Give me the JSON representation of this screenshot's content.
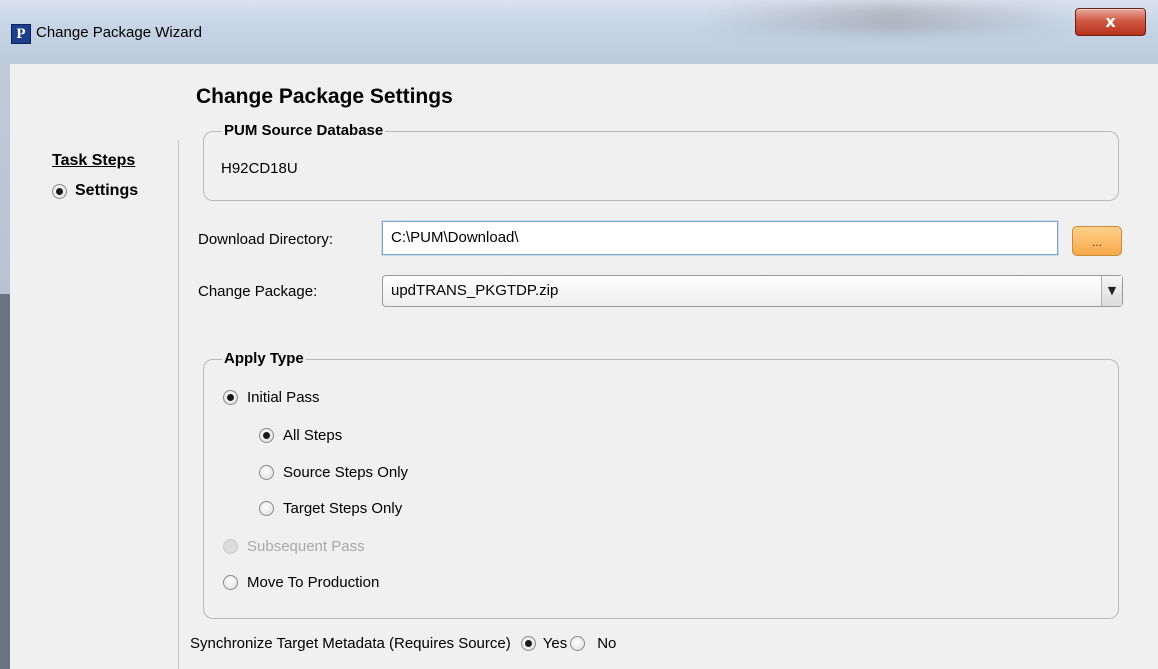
{
  "window": {
    "title": "Change Package Wizard",
    "icon_letter": "P",
    "close_glyph": "x"
  },
  "sidebar": {
    "title": "Task Steps",
    "items": [
      {
        "label": "Settings",
        "selected": true
      }
    ]
  },
  "main": {
    "heading": "Change Package Settings",
    "source_db": {
      "legend": "PUM Source Database",
      "value": "H92CD18U"
    },
    "download_directory": {
      "label": "Download Directory:",
      "value": "C:\\PUM\\Download\\",
      "browse_label": "..."
    },
    "change_package": {
      "label": "Change Package:",
      "selected": "updTRANS_PKGTDP.zip"
    },
    "apply_type": {
      "legend": "Apply Type",
      "options": [
        {
          "label": "Initial Pass",
          "checked": true,
          "enabled": true
        },
        {
          "label": "All Steps",
          "checked": true,
          "enabled": true
        },
        {
          "label": "Source Steps Only",
          "checked": false,
          "enabled": true
        },
        {
          "label": "Target Steps Only",
          "checked": false,
          "enabled": true
        },
        {
          "label": "Subsequent Pass",
          "checked": false,
          "enabled": false
        },
        {
          "label": "Move To Production",
          "checked": false,
          "enabled": true
        }
      ]
    },
    "sync": {
      "label": "Synchronize Target Metadata (Requires Source)",
      "yes_label": "Yes",
      "no_label": "No",
      "selected": "Yes"
    }
  },
  "colors": {
    "browse_button": "#f7a94a",
    "close_button": "#c9442c",
    "field_focus_border": "#7ea2c8"
  }
}
